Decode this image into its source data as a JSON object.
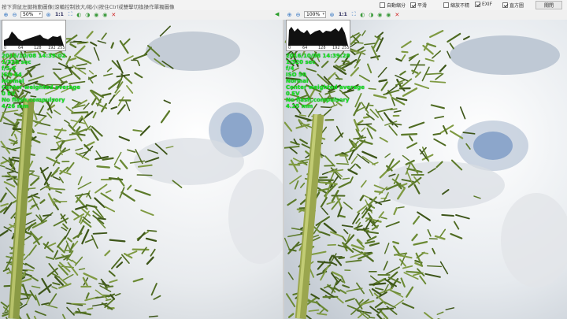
{
  "header": {
    "hint": "按下滑鼠左鍵拖動圖像|滾輪控制放大/縮小|按住Ctrl或雙擊切換操作單獨圖像",
    "options": [
      {
        "label": "自動縮分",
        "checked": false
      },
      {
        "label": "平滑",
        "checked": true
      },
      {
        "label": "縮放不精",
        "checked": false
      },
      {
        "label": "EXIF",
        "checked": true
      },
      {
        "label": "直方圖",
        "checked": true
      }
    ],
    "close_label": "關閉"
  },
  "left_pane": {
    "zoom": "50%",
    "one_to_one": "1:1",
    "hist_ticks": [
      "0",
      "64",
      "128",
      "192",
      "255"
    ],
    "exif": [
      "2016/10/08 14:39:02",
      "1/320 sec",
      "f/5.6",
      "ISO 64",
      "Normal",
      "Center weighted average",
      "0 EV",
      "No flash,compulsory",
      "4.26 mm"
    ]
  },
  "right_pane": {
    "zoom": "100%",
    "one_to_one": "1:1",
    "hist_ticks": [
      "0",
      "64",
      "128",
      "192",
      "255"
    ],
    "exif": [
      "2016/10/08 14:39:28",
      "1/320 sec",
      "f/4",
      "ISO 50",
      "Normal",
      "Center weighted average",
      "0 EV",
      "No flash,compulsory",
      "4.25 mm"
    ]
  },
  "icons": [
    "zoom-in-icon",
    "zoom-out-icon",
    "fit-icon",
    "fit-window-icon",
    "rotate-left-icon",
    "rotate-right-icon",
    "prev-icon",
    "next-icon",
    "delete-icon",
    "sync-arrow-icon"
  ],
  "colors": {
    "exif_text": "#19e61b",
    "sky": "#eef1f4",
    "foliage": "#5e7a2d"
  }
}
